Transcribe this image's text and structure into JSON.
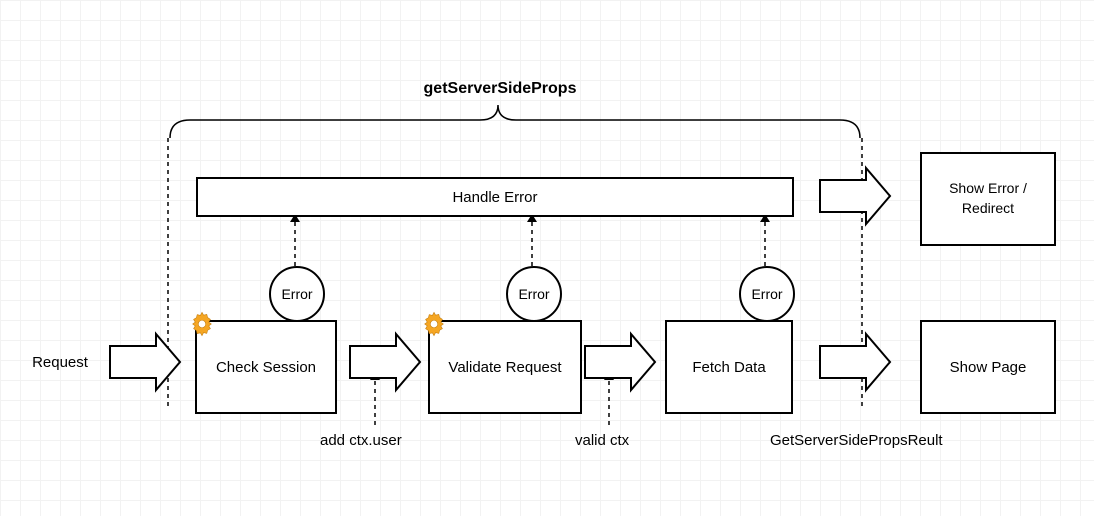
{
  "title": "getServerSideProps",
  "handle_error": "Handle Error",
  "request_label": "Request",
  "steps": {
    "check_session": "Check Session",
    "validate_request": "Validate Request",
    "fetch_data": "Fetch Data"
  },
  "error_label": "Error",
  "outputs": {
    "show_error": "Show Error / Redirect",
    "show_page": "Show Page"
  },
  "annotations": {
    "add_ctx_user": "add ctx.user",
    "valid_ctx": "valid ctx",
    "result": "GetServerSidePropsReult"
  },
  "icons": {
    "gear": "gear-icon"
  }
}
